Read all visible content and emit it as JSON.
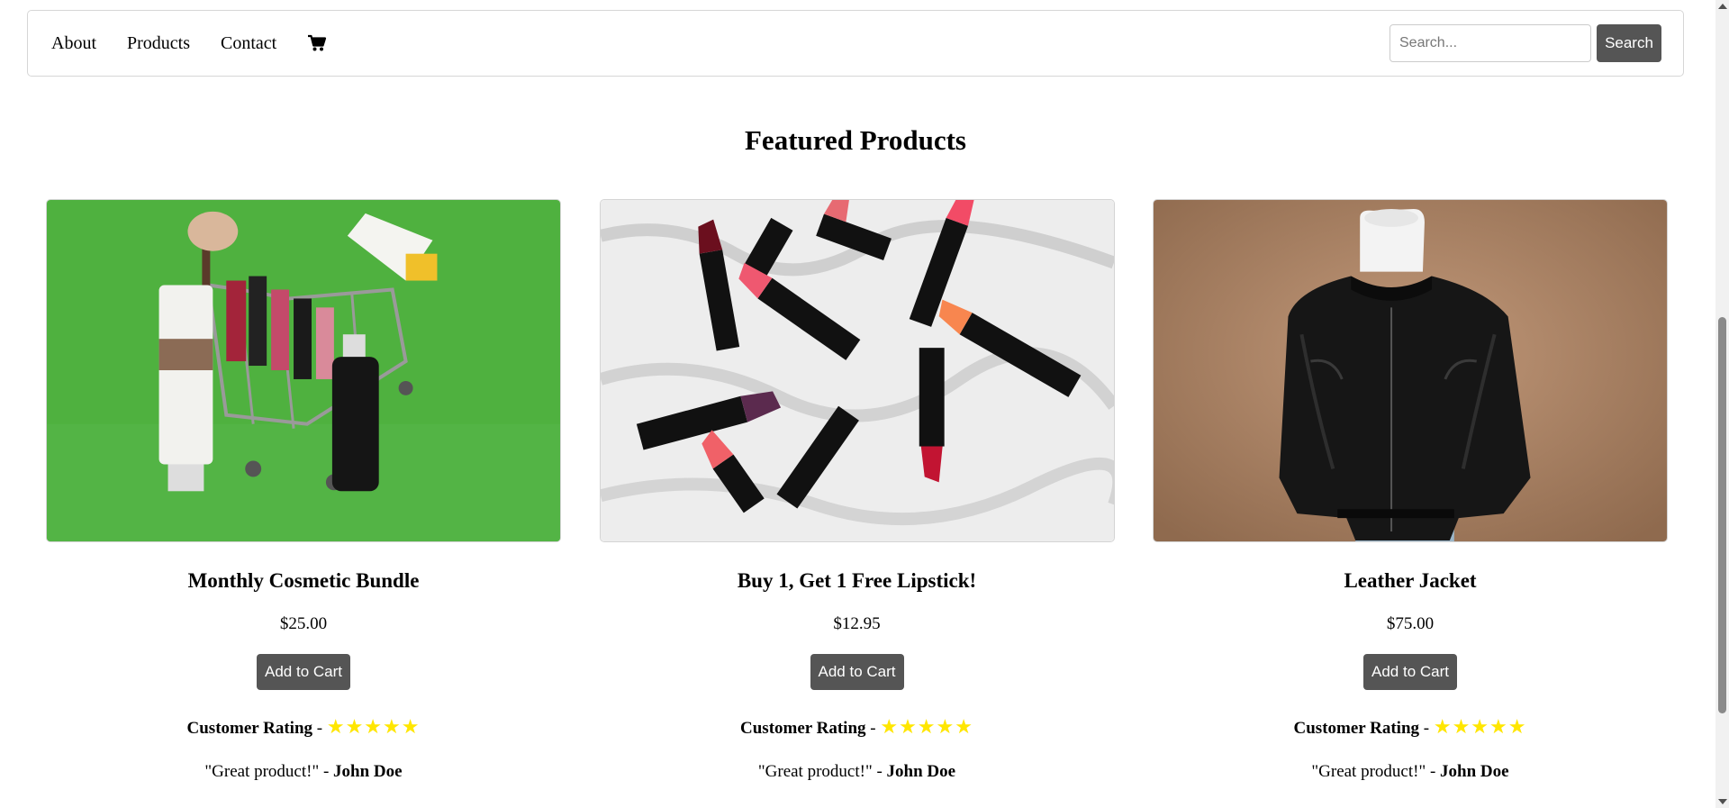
{
  "nav": {
    "links": [
      "About",
      "Products",
      "Contact"
    ],
    "cart_icon": "shopping-cart-icon",
    "search_placeholder": "Search...",
    "search_button": "Search"
  },
  "section_title": "Featured Products",
  "products": [
    {
      "name": "Monthly Cosmetic Bundle",
      "price": "$25.00",
      "button": "Add to Cart",
      "rating_label": "Customer Rating",
      "rating_sep": " - ",
      "stars": "★★★★★",
      "review_quote": "\"Great product!\" - ",
      "review_author": "John Doe"
    },
    {
      "name": "Buy 1, Get 1 Free Lipstick!",
      "price": "$12.95",
      "button": "Add to Cart",
      "rating_label": "Customer Rating",
      "rating_sep": " - ",
      "stars": "★★★★★",
      "review_quote": "\"Great product!\" - ",
      "review_author": "John Doe"
    },
    {
      "name": "Leather Jacket",
      "price": "$75.00",
      "button": "Add to Cart",
      "rating_label": "Customer Rating",
      "rating_sep": " - ",
      "stars": "★★★★★",
      "review_quote": "\"Great product!\" - ",
      "review_author": "John Doe"
    }
  ],
  "colors": {
    "button_bg": "#555555",
    "star": "#ffe600"
  }
}
